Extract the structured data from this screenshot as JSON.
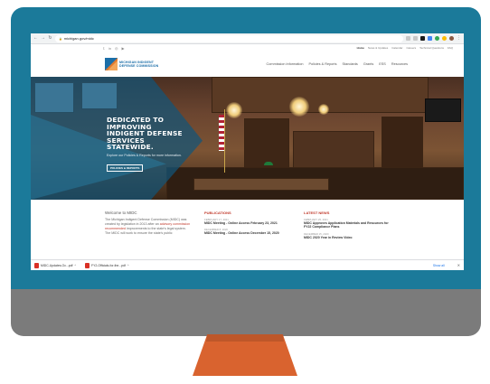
{
  "browser": {
    "url": "michigan.gov/midc",
    "back": "←",
    "forward": "→",
    "reload": "↻",
    "lock": "🔒"
  },
  "social": {
    "icons": [
      "twitter-icon",
      "linkedin-icon",
      "instagram-icon",
      "youtube-icon"
    ],
    "glyphs": [
      "𝕥",
      "in",
      "◎",
      "▶"
    ]
  },
  "utility_links": [
    "Home",
    "News & Updates",
    "Calendar",
    "Careers",
    "Technical Questions",
    "FAQ"
  ],
  "site": {
    "logo_line1": "MICHIGAN INDIGENT",
    "logo_line2": "DEFENSE COMMISSION"
  },
  "main_nav": [
    "Commission Information",
    "Policies & Reports",
    "Standards",
    "Grants",
    "ESS",
    "Resources"
  ],
  "hero": {
    "title_line1": "DEDICATED TO IMPROVING",
    "title_line2": "INDIGENT DEFENSE SERVICES",
    "title_line3": "STATEWIDE.",
    "subtitle": "Explore our Policies & Reports for more information.",
    "button": "POLICIES & REPORTS"
  },
  "welcome": {
    "heading": "Welcome to MIDC",
    "text1": "The Michigan Indigent Defense Commission (MIDC) was created by legislation in 2013 after an",
    "accent": "advisory commission recommended",
    "text2": "improvements to the state's legal system. The MIDC will work to ensure the state's public"
  },
  "publications": {
    "heading": "PUBLICATIONS",
    "items": [
      {
        "date": "FEBRUARY 17, 2021",
        "title": "MIDC Meeting - Online Access February 23, 2021"
      },
      {
        "date": "DECEMBER 8, 2020",
        "title": "MIDC Meeting - Online Access December 15, 2020"
      }
    ]
  },
  "latest_news": {
    "heading": "LATEST NEWS",
    "items": [
      {
        "date": "FEBRUARY 25, 2021",
        "title": "MIDC Approves Application Materials and Resources for FY22 Compliance Plans"
      },
      {
        "date": "DECEMBER 15, 2020",
        "title": "MIDC 2020 Year in Review Video"
      }
    ]
  },
  "downloads": {
    "items": [
      "MIDC-Updates-Oc...pdf",
      "FY2-Officials-for-the...pdf"
    ],
    "show_all": "Show all",
    "close": "✕",
    "chevron": "^"
  },
  "colors": {
    "bezel": "#1b7a9a",
    "chin": "#7b7b7b",
    "stand": "#d9632f",
    "accent_red": "#c0392b",
    "brand_blue": "#1b6ea8"
  }
}
